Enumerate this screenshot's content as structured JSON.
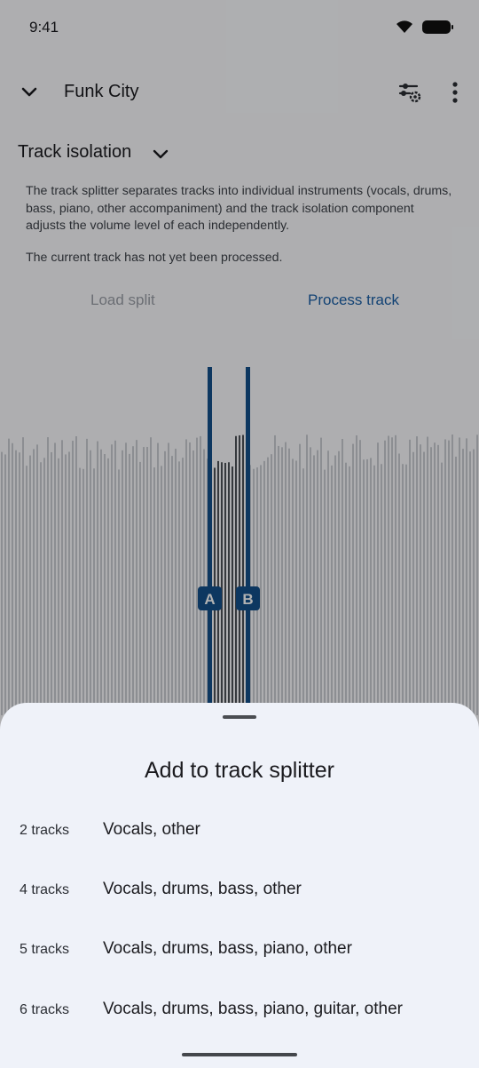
{
  "status_bar": {
    "time": "9:41"
  },
  "app_bar": {
    "title": "Funk City"
  },
  "track_isolation": {
    "header": "Track isolation",
    "description": "The track splitter separates tracks into individual instruments (vocals, drums, bass, piano, other accompaniment) and the track isolation component adjusts the volume level of each independently.",
    "status": "The current track has not yet been processed.",
    "load_split_label": "Load split",
    "process_track_label": "Process track"
  },
  "markers": {
    "a_label": "A",
    "b_label": "B"
  },
  "sheet": {
    "title": "Add to track splitter",
    "options": [
      {
        "count": "2 tracks",
        "instruments": "Vocals, other"
      },
      {
        "count": "4 tracks",
        "instruments": "Vocals, drums, bass, other"
      },
      {
        "count": "5 tracks",
        "instruments": "Vocals, drums, bass, piano, other"
      },
      {
        "count": "6 tracks",
        "instruments": "Vocals, drums, bass, piano, guitar, other"
      }
    ]
  },
  "colors": {
    "accent": "#1a5fa6",
    "marker": "#13508a",
    "sheet_bg": "#eff2f9"
  },
  "icons": [
    "chevron-down-icon",
    "filter-settings-icon",
    "more-vert-icon",
    "wifi-icon",
    "battery-icon"
  ]
}
